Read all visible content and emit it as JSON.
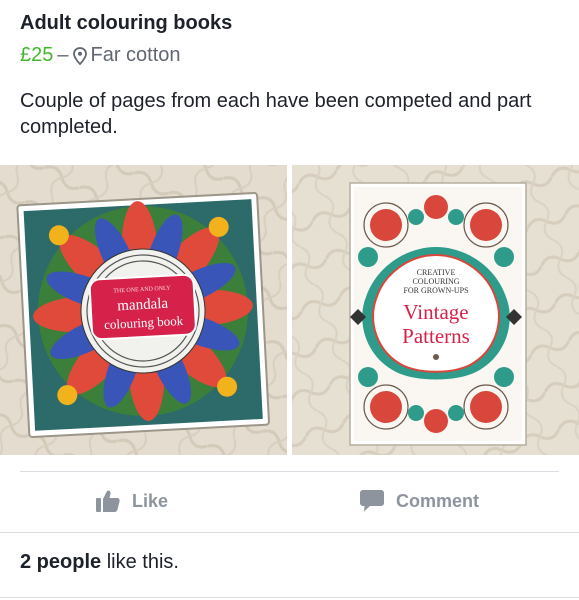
{
  "post": {
    "title": "Adult colouring books",
    "price": "£25",
    "separator": "–",
    "location": "Far cotton",
    "description": "Couple of pages from each have been competed and part completed."
  },
  "photos": [
    {
      "label_small": "THE ONE AND ONLY",
      "label_line1": "mandala",
      "label_line2": "colouring book"
    },
    {
      "label_small_1": "CREATIVE",
      "label_small_2": "COLOURING",
      "label_small_3": "FOR GROWN-UPS",
      "label_line1": "Vintage",
      "label_line2": "Patterns"
    }
  ],
  "actions": {
    "like_label": "Like",
    "comment_label": "Comment"
  },
  "likes": {
    "count_text": "2 people",
    "suffix_text": " like this."
  },
  "icons": {
    "location": "map-pin-icon",
    "like": "thumbs-up-icon",
    "comment": "speech-bubble-icon"
  },
  "colors": {
    "price": "#42b72a",
    "muted": "#606770",
    "action": "#8d949e"
  }
}
